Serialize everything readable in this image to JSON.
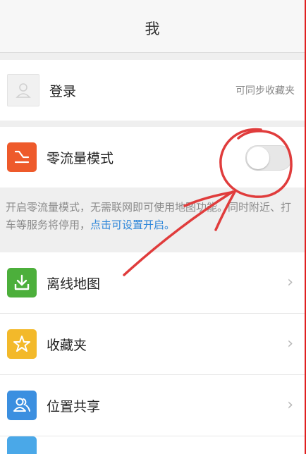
{
  "header": {
    "title": "我"
  },
  "login": {
    "label": "登录",
    "hint": "可同步收藏夹"
  },
  "zero_flow": {
    "label": "零流量模式",
    "enabled": false
  },
  "info": {
    "text": "开启零流量模式，无需联网即可使用地图功能。同时附近、打车等服务将停用，",
    "link": "点击可设置开启。"
  },
  "menu": {
    "items": [
      {
        "label": "离线地图",
        "icon": "download-icon",
        "color": "#4caf3b"
      },
      {
        "label": "收藏夹",
        "icon": "star-icon",
        "color": "#f3b92a"
      },
      {
        "label": "位置共享",
        "icon": "users-icon",
        "color": "#3b8fe0"
      }
    ]
  },
  "colors": {
    "accent_link": "#2d86d9",
    "zero_flow_icon": "#ee5a2b",
    "annotation": "#e03c3c"
  }
}
